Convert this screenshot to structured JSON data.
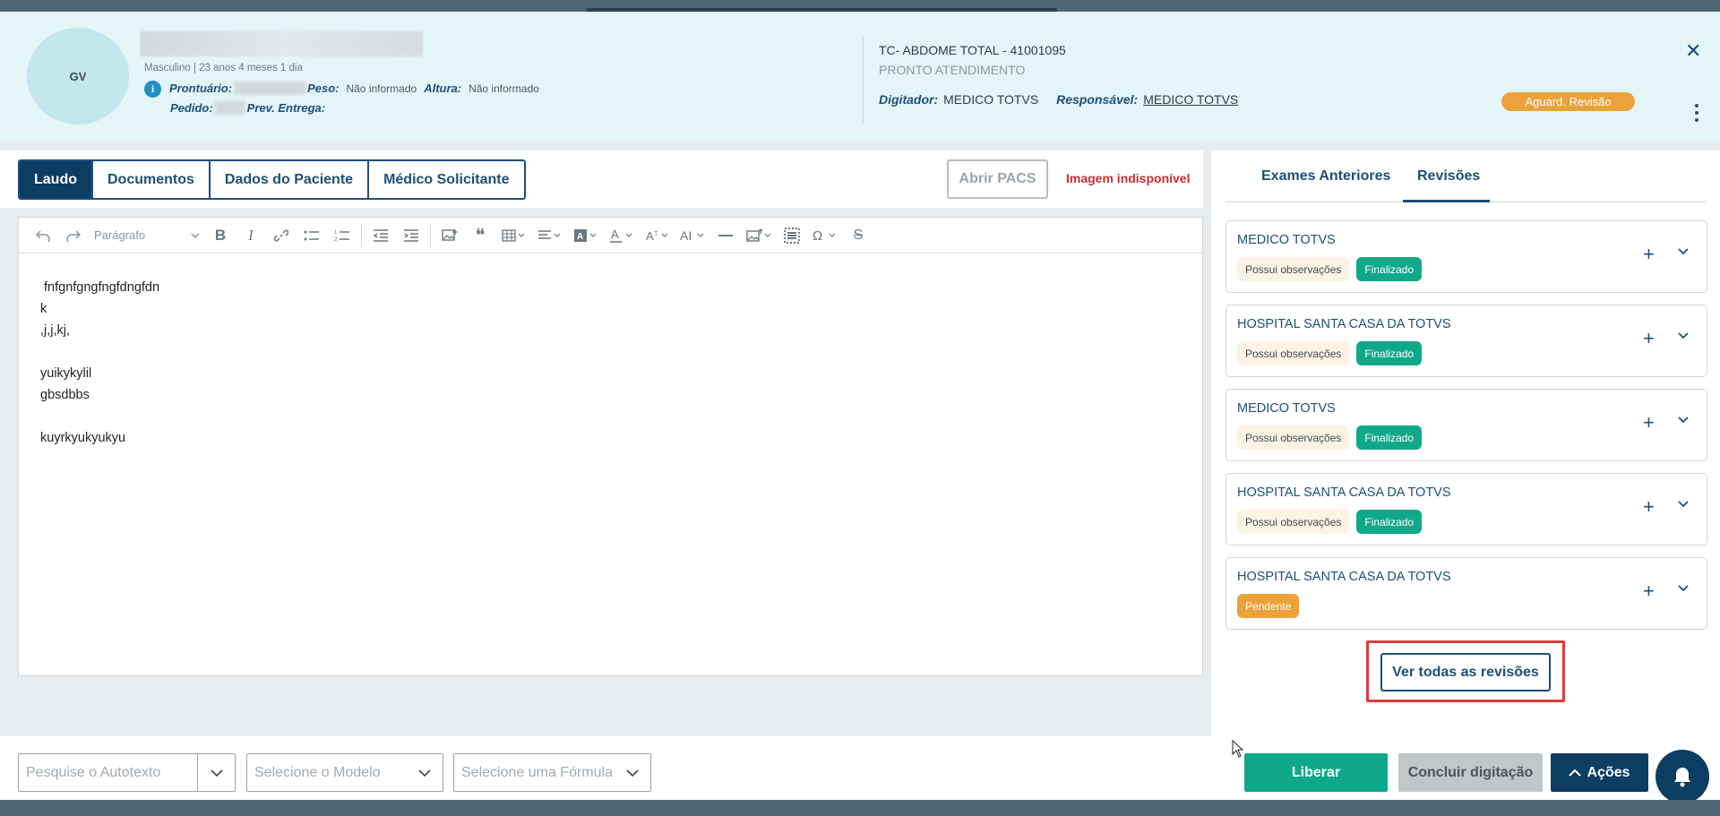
{
  "header": {
    "avatar_initials": "GV",
    "patient_meta": "Masculino | 23 anos 4 meses 1 dia",
    "prontuario_label": "Prontuário:",
    "peso_label": "Peso:",
    "peso_value": "Não informado",
    "altura_label": "Altura:",
    "altura_value": "Não informado",
    "pedido_label": "Pedido:",
    "prev_entrega_label": "Prev. Entrega:",
    "exam_title": "TC- ABDOME TOTAL - 41001095",
    "exam_subtitle": "PRONTO ATENDIMENTO",
    "digitador_label": "Digitador:",
    "digitador_value": "MEDICO TOTVS",
    "responsavel_label": "Responsável:",
    "responsavel_value": "MEDICO TOTVS",
    "status": "Aguard. Revisão",
    "status_color": "#eaa23b"
  },
  "tabs": [
    "Laudo",
    "Documentos",
    "Dados do Paciente",
    "Médico Solicitante"
  ],
  "actions": {
    "abrir_pacs": "Abrir PACS",
    "image_unavailable": "Imagem indisponível"
  },
  "editor": {
    "paragraph_style": "Parágrafo",
    "lines": [
      " fnfgnfgngfngfdngfdn",
      "k",
      ",j,j,kj,",
      "",
      "yuikykylil",
      "gbsdbbs",
      "",
      "kuyrkyukyukyu"
    ]
  },
  "right": {
    "tabs": [
      "Exames Anteriores",
      "Revisões"
    ],
    "active_tab": "Revisões",
    "revisions": [
      {
        "title": "MEDICO TOTVS",
        "badges": [
          "Possui observações",
          "Finalizado"
        ]
      },
      {
        "title": "HOSPITAL SANTA CASA DA TOTVS",
        "badges": [
          "Possui observações",
          "Finalizado"
        ]
      },
      {
        "title": "MEDICO TOTVS",
        "badges": [
          "Possui observações",
          "Finalizado"
        ]
      },
      {
        "title": "HOSPITAL SANTA CASA DA TOTVS",
        "badges": [
          "Possui observações",
          "Finalizado"
        ]
      },
      {
        "title": "HOSPITAL SANTA CASA DA TOTVS",
        "badges": [
          "Pendente"
        ]
      }
    ],
    "see_all": "Ver todas as revisões"
  },
  "footer": {
    "autotexto_placeholder": "Pesquise o Autotexto",
    "modelo_placeholder": "Selecione o Modelo",
    "formula_placeholder": "Selecione uma Fórmula",
    "liberar": "Liberar",
    "concluir": "Concluir digitação",
    "acoes": "Ações"
  },
  "colors": {
    "primary": "#0c3d63",
    "success": "#0fa98a",
    "warning": "#eaa23b",
    "header_bg": "#e4f5f8"
  }
}
